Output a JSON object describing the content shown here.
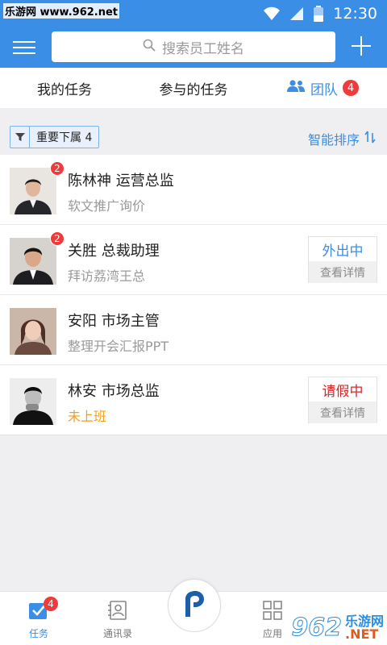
{
  "status_bar": {
    "watermark": "乐游网 www.962.net",
    "time": "12:30"
  },
  "header": {
    "search_placeholder": "搜索员工姓名"
  },
  "tabs": [
    {
      "label": "我的任务"
    },
    {
      "label": "参与的任务"
    },
    {
      "label": "团队",
      "badge": "4"
    }
  ],
  "filter": {
    "label": "重要下属 4",
    "sort_label": "智能排序"
  },
  "members": [
    {
      "name": "陈林神  运营总监",
      "task": "软文推广询价",
      "badge": "2",
      "status": "",
      "detail": ""
    },
    {
      "name": "关胜  总裁助理",
      "task": "拜访荔湾王总",
      "badge": "2",
      "status": "外出中",
      "detail": "查看详情"
    },
    {
      "name": "安阳  市场主管",
      "task": "整理开会汇报PPT",
      "badge": "",
      "status": "",
      "detail": ""
    },
    {
      "name": "林安  市场总监",
      "task": "未上班",
      "badge": "",
      "status": "请假中",
      "detail": "查看详情"
    }
  ],
  "bottom_nav": {
    "tasks_label": "任务",
    "tasks_badge": "4",
    "contacts_label": "通讯录",
    "apps_label": "应用"
  },
  "watermark_br": {
    "num": "962",
    "line1": "乐游网",
    "line2": ".NET"
  },
  "colors": {
    "primary": "#3a8ee6",
    "badge": "#f23a3a",
    "warn": "#f0a020",
    "leave": "#d42a2a"
  }
}
